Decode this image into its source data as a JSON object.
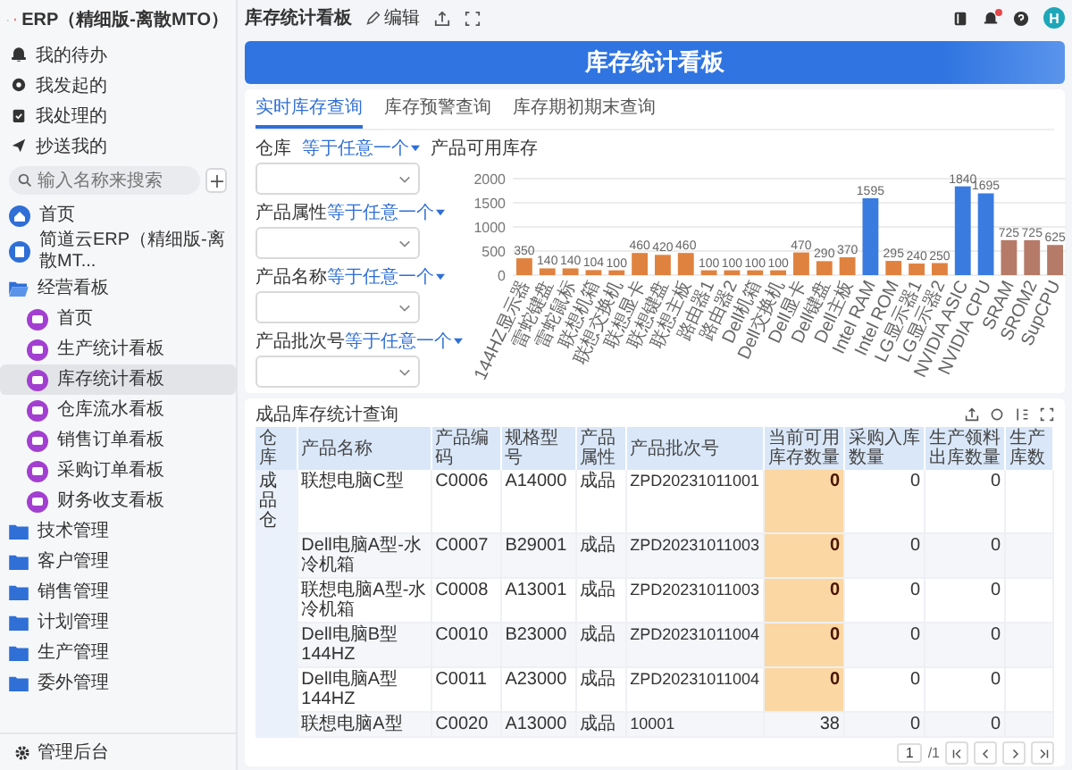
{
  "app": {
    "title": "ERP（精细版-离散MTO）"
  },
  "quick_links": [
    {
      "label": "我的待办"
    },
    {
      "label": "我发起的"
    },
    {
      "label": "我处理的"
    },
    {
      "label": "抄送我的"
    }
  ],
  "search": {
    "placeholder": "输入名称来搜索"
  },
  "nav": [
    {
      "label": "首页",
      "kind": "home",
      "selected": false
    },
    {
      "label": "简道云ERP（精细版-离散MT...",
      "kind": "app",
      "selected": false
    },
    {
      "label": "经营看板",
      "kind": "folder",
      "expanded": true,
      "selected": false,
      "children": [
        {
          "label": "首页",
          "selected": false
        },
        {
          "label": "生产统计看板",
          "selected": false
        },
        {
          "label": "库存统计看板",
          "selected": true
        },
        {
          "label": "仓库流水看板",
          "selected": false
        },
        {
          "label": "销售订单看板",
          "selected": false
        },
        {
          "label": "采购订单看板",
          "selected": false
        },
        {
          "label": "财务收支看板",
          "selected": false
        }
      ]
    },
    {
      "label": "技术管理",
      "kind": "folder",
      "expanded": false,
      "selected": false
    },
    {
      "label": "客户管理",
      "kind": "folder",
      "expanded": false,
      "selected": false
    },
    {
      "label": "销售管理",
      "kind": "folder",
      "expanded": false,
      "selected": false
    },
    {
      "label": "计划管理",
      "kind": "folder",
      "expanded": false,
      "selected": false
    },
    {
      "label": "生产管理",
      "kind": "folder",
      "expanded": false,
      "selected": false
    },
    {
      "label": "委外管理",
      "kind": "folder",
      "expanded": false,
      "selected": false
    }
  ],
  "footer": {
    "label": "管理后台"
  },
  "header": {
    "title": "库存统计看板",
    "edit": "编辑",
    "notification": true,
    "avatar": "H"
  },
  "banner": {
    "title": "库存统计看板"
  },
  "tabs": [
    {
      "label": "实时库存查询",
      "selected": true
    },
    {
      "label": "库存预警查询",
      "selected": false
    },
    {
      "label": "库存期初期末查询",
      "selected": false
    }
  ],
  "filters": [
    {
      "label": "仓库",
      "operator": "等于任意一个"
    },
    {
      "label": "产品属性",
      "operator": "等于任意一个"
    },
    {
      "label": "产品名称",
      "operator": "等于任意一个"
    },
    {
      "label": "产品批次号",
      "operator": "等于任意一个"
    }
  ],
  "chart": {
    "chart_data": {
      "type": "bar",
      "title": "产品可用库存",
      "categories": [
        "144HZ显示器",
        "雷蛇键盘",
        "雷蛇鼠标",
        "联想机箱",
        "联想交换机",
        "联想显卡",
        "联想键盘",
        "联想主板",
        "路由器1",
        "路由器2",
        "Dell机箱",
        "Dell交换机",
        "Dell显卡",
        "Dell键盘",
        "Dell主板",
        "Intel RAM",
        "Intel ROM",
        "LG显示器1",
        "LG显示器2",
        "NVIDIA ASIC",
        "NVIDIA CPU",
        "SRAM",
        "SROM2",
        "SupCPU"
      ],
      "series": [
        {
          "color": "#e0823f",
          "values": [
            350,
            140,
            140,
            104,
            100,
            460,
            420,
            460,
            100,
            100,
            100,
            100,
            470,
            290,
            370,
            null,
            295,
            240,
            250,
            null,
            null,
            null,
            null,
            null
          ]
        },
        {
          "color": "#3a7be0",
          "values": [
            null,
            null,
            null,
            null,
            null,
            null,
            null,
            null,
            null,
            null,
            null,
            null,
            null,
            null,
            null,
            1595,
            null,
            null,
            null,
            1840,
            1695,
            null,
            null,
            null
          ]
        },
        {
          "color": "#b57a68",
          "values": [
            null,
            null,
            null,
            null,
            null,
            null,
            null,
            null,
            null,
            null,
            null,
            null,
            null,
            null,
            null,
            null,
            null,
            null,
            null,
            null,
            null,
            725,
            725,
            625
          ]
        }
      ],
      "ylim": [
        0,
        2000
      ],
      "grid": true,
      "yticks": [
        0,
        500,
        1000,
        1500,
        2000
      ],
      "stacked": true,
      "data_labels": true
    }
  },
  "table": {
    "title": "成品库存统计查询",
    "columns": [
      "仓库",
      "产品名称",
      "产品编码",
      "规格型号",
      "产品属性",
      "产品批次号",
      "当前可用库存数量",
      "采购入库数量",
      "生产领料出库数量",
      "生产库数"
    ],
    "rows": [
      {
        "cells": [
          "成品仓",
          "联想电脑C型",
          "C0006",
          "A14000",
          "成品",
          "ZPD20231011001",
          "0",
          "0",
          "0"
        ],
        "warning": true
      },
      {
        "cells": [
          "",
          "Dell电脑A型-水冷机箱",
          "C0007",
          "B29001",
          "成品",
          "ZPD20231011003",
          "0",
          "0",
          "0"
        ],
        "warning": true
      },
      {
        "cells": [
          "",
          "联想电脑A型-水冷机箱",
          "C0008",
          "A13001",
          "成品",
          "ZPD20231011003",
          "0",
          "0",
          "0"
        ],
        "warning": true
      },
      {
        "cells": [
          "",
          "Dell电脑B型 144HZ",
          "C0010",
          "B23000",
          "成品",
          "ZPD20231011004",
          "0",
          "0",
          "0"
        ],
        "warning": true
      },
      {
        "cells": [
          "",
          "Dell电脑A型 144HZ",
          "C0011",
          "A23000",
          "成品",
          "ZPD20231011004",
          "0",
          "0",
          "0"
        ],
        "warning": true
      },
      {
        "cells": [
          "",
          "联想电脑A型",
          "C0020",
          "A13000",
          "成品",
          "10001",
          "38",
          "0",
          "0"
        ],
        "warning": false
      }
    ]
  },
  "pagination": {
    "page": "1",
    "total": "/1"
  }
}
